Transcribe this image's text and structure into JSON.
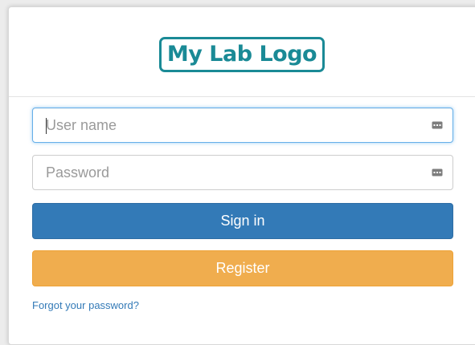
{
  "header": {
    "logo_text": "My Lab Logo",
    "logo_color": "#1a8a96"
  },
  "form": {
    "username": {
      "placeholder": "User name",
      "value": "",
      "icon": "key-icon"
    },
    "password": {
      "placeholder": "Password",
      "value": "",
      "icon": "key-icon"
    },
    "signin_label": "Sign in",
    "register_label": "Register",
    "forgot_label": "Forgot your password?"
  },
  "colors": {
    "primary": "#337ab7",
    "warning": "#f0ad4e",
    "focus": "#66afe9"
  }
}
